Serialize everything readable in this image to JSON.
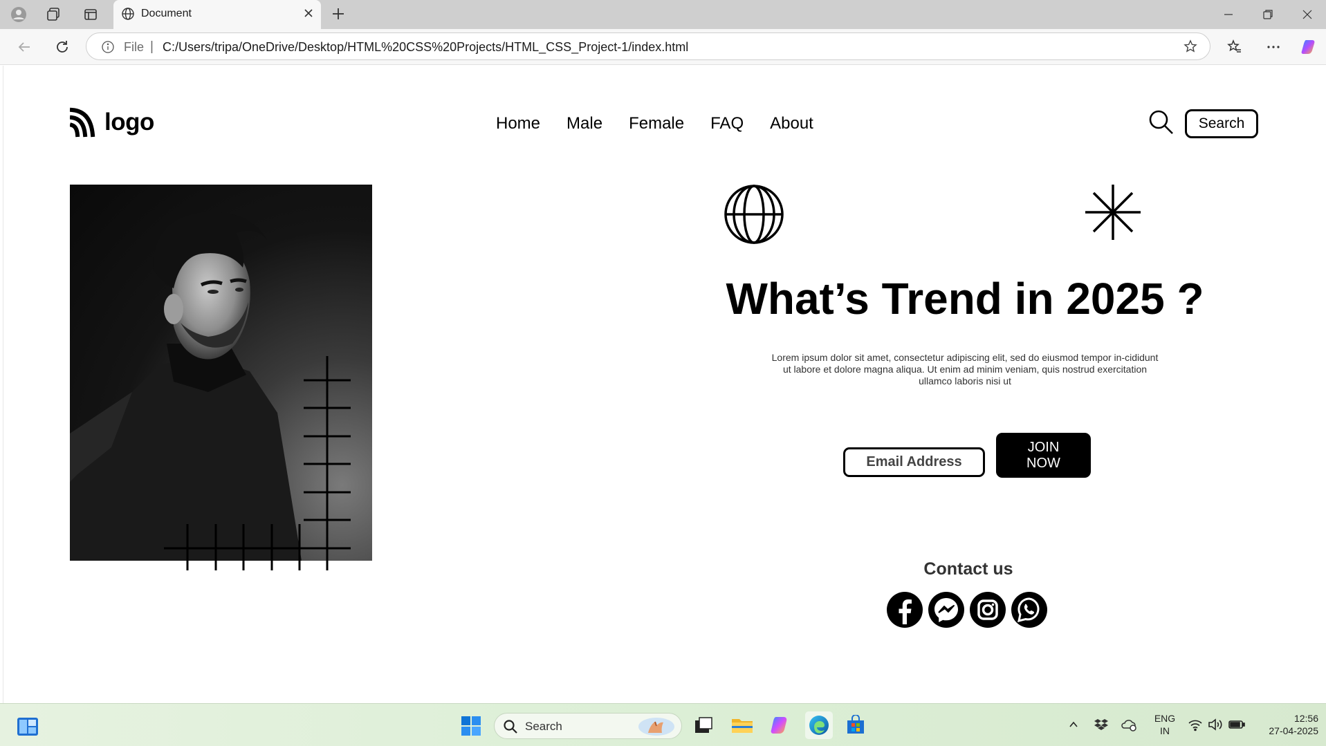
{
  "browser": {
    "tab_title": "Document",
    "address_scheme_label": "File",
    "address_separator": "|",
    "url": "C:/Users/tripa/OneDrive/Desktop/HTML%20CSS%20Projects/HTML_CSS_Project-1/index.html"
  },
  "site": {
    "logo_text": "logo",
    "nav": [
      "Home",
      "Male",
      "Female",
      "FAQ",
      "About"
    ],
    "search_button": "Search",
    "headline": "What’s Trend in 2025 ?",
    "lorem": "Lorem ipsum dolor sit amet, consectetur adipiscing elit, sed do eiusmod tempor in-cididunt ut labore et dolore magna aliqua. Ut enim ad minim veniam, quis nostrud exercitation ullamco laboris nisi ut",
    "email_label": "Email Address",
    "join_line1": "JOIN",
    "join_line2": "NOW",
    "contact_title": "Contact us",
    "social": [
      "facebook-icon",
      "messenger-icon",
      "instagram-icon",
      "whatsapp-icon"
    ]
  },
  "taskbar": {
    "search_label": "Search",
    "lang_line1": "ENG",
    "lang_line2": "IN",
    "time": "12:56",
    "date": "27-04-2025"
  },
  "colors": {
    "accent": "#000000",
    "taskbar_bg": "#dcefd6",
    "chrome_bg": "#cfcfcf"
  }
}
